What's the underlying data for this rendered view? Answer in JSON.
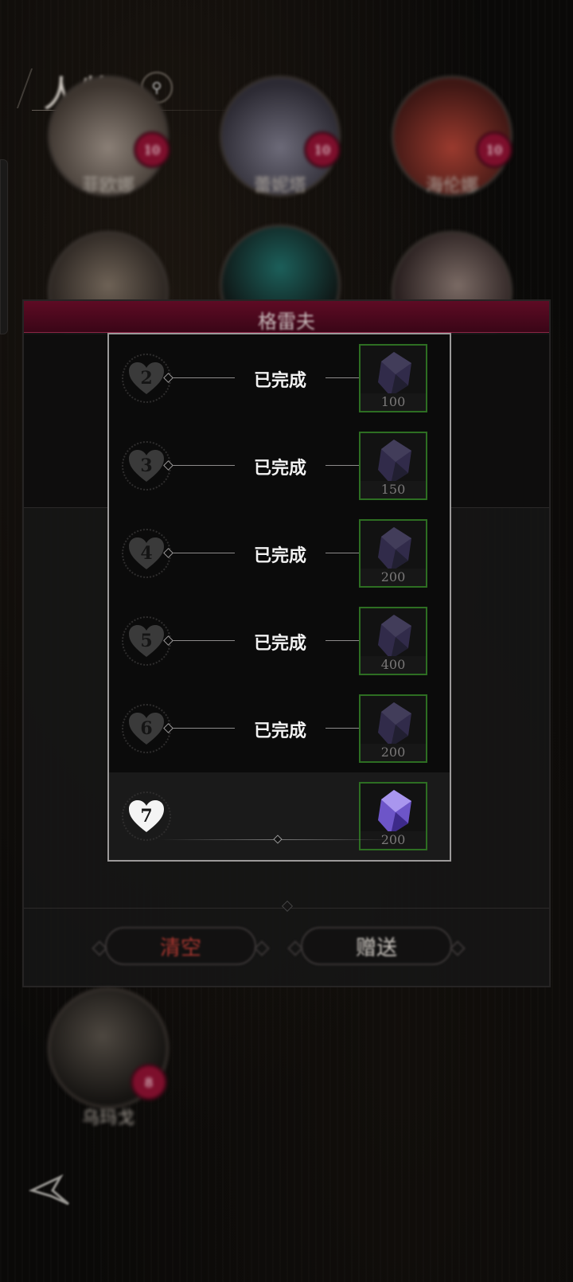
{
  "header": {
    "title": "人物",
    "search_icon": "search-icon"
  },
  "characters_top": [
    {
      "name": "菲欧娜",
      "badge": "10"
    },
    {
      "name": "蕾妮塔",
      "badge": "10"
    },
    {
      "name": "海伦娜",
      "badge": "10"
    }
  ],
  "characters_bottom": [
    {
      "name": "乌玛戈",
      "badge": "8"
    }
  ],
  "dialog": {
    "character_name": "格雷夫",
    "clear_label": "清空",
    "give_label": "赠送"
  },
  "rewards": [
    {
      "level": "2",
      "status": "已完成",
      "amount": "100"
    },
    {
      "level": "3",
      "status": "已完成",
      "amount": "150"
    },
    {
      "level": "4",
      "status": "已完成",
      "amount": "200"
    },
    {
      "level": "5",
      "status": "已完成",
      "amount": "400"
    },
    {
      "level": "6",
      "status": "已完成",
      "amount": "200"
    },
    {
      "level": "7",
      "status": "",
      "amount": "200"
    }
  ],
  "colors": {
    "accent_crimson": "#5e0b24",
    "gem_border": "#2d6e22",
    "gem_purple": "#7a5fd0",
    "clear_red": "#a8362f"
  }
}
